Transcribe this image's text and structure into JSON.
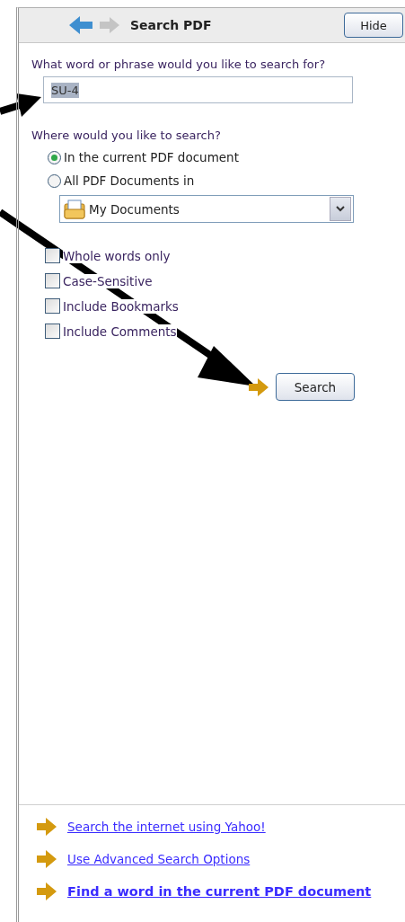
{
  "header": {
    "title": "Search PDF",
    "hide_button": "Hide"
  },
  "query": {
    "label": "What word or phrase would you like to search for?",
    "value": "SU-4",
    "value_selected": true
  },
  "location": {
    "label": "Where would you like to search?",
    "options": [
      {
        "label": "In the current PDF document",
        "selected": true
      },
      {
        "label": "All PDF Documents in",
        "selected": false
      }
    ],
    "folder": "My Documents"
  },
  "options": [
    {
      "label": "Whole words only",
      "checked": false
    },
    {
      "label": "Case-Sensitive",
      "checked": false
    },
    {
      "label": "Include Bookmarks",
      "checked": false
    },
    {
      "label": "Include Comments",
      "checked": false
    }
  ],
  "search_button": "Search",
  "links": [
    {
      "label": "Search the internet using Yahoo!",
      "bold": false
    },
    {
      "label": "Use Advanced Search Options",
      "bold": false
    },
    {
      "label": "Find a word in the current PDF document",
      "bold": true
    }
  ]
}
